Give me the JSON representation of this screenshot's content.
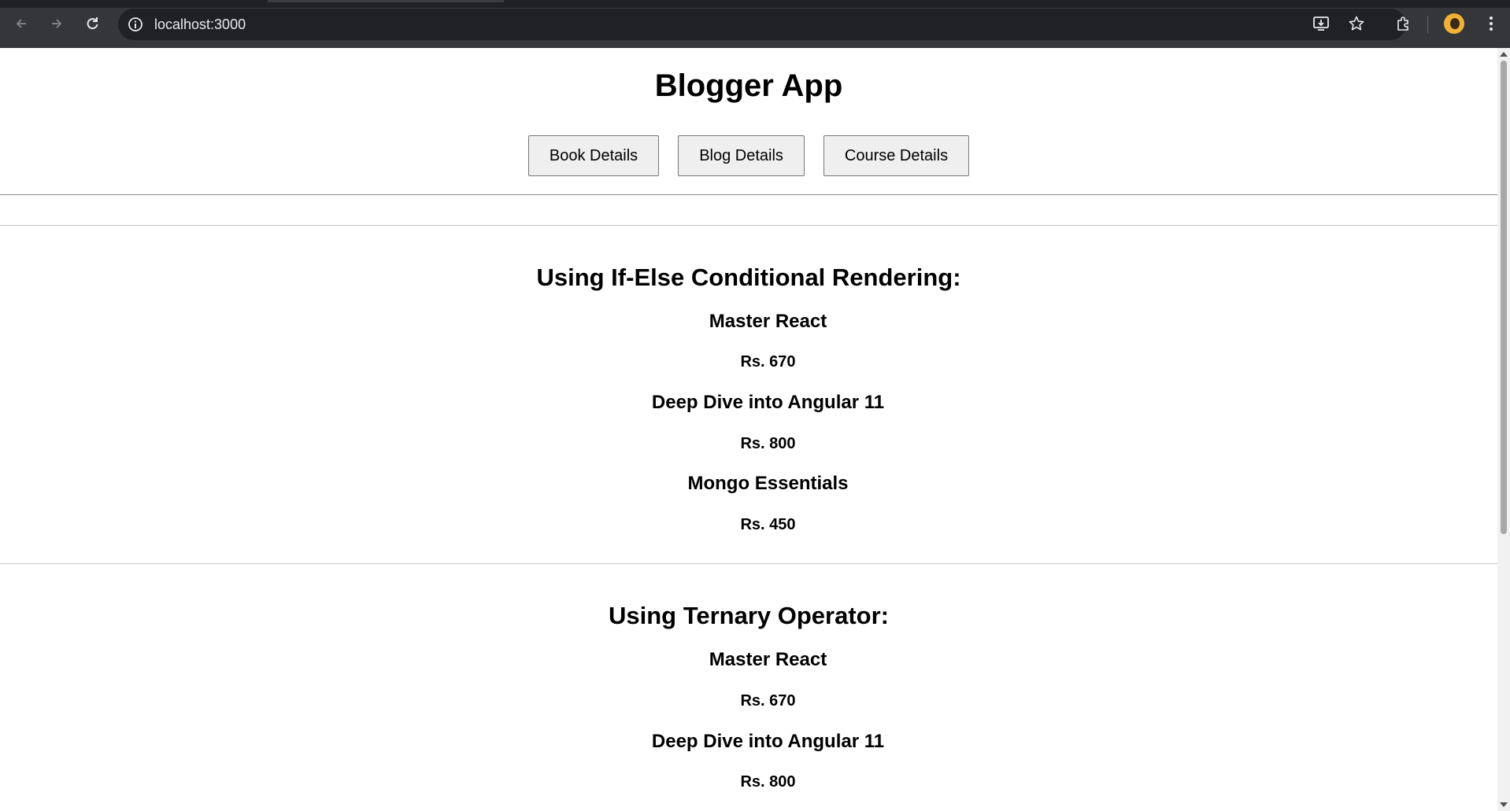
{
  "browser": {
    "url": "localhost:3000"
  },
  "page": {
    "title": "Blogger App",
    "buttons": [
      "Book Details",
      "Blog Details",
      "Course Details"
    ],
    "sections": [
      {
        "heading": "Using If-Else Conditional Rendering:",
        "books": [
          {
            "name": "Master React",
            "price": "Rs. 670"
          },
          {
            "name": "Deep Dive into Angular 11",
            "price": "Rs. 800"
          },
          {
            "name": "Mongo Essentials",
            "price": "Rs. 450"
          }
        ]
      },
      {
        "heading": "Using Ternary Operator:",
        "books": [
          {
            "name": "Master React",
            "price": "Rs. 670"
          },
          {
            "name": "Deep Dive into Angular 11",
            "price": "Rs. 800"
          }
        ]
      }
    ]
  }
}
